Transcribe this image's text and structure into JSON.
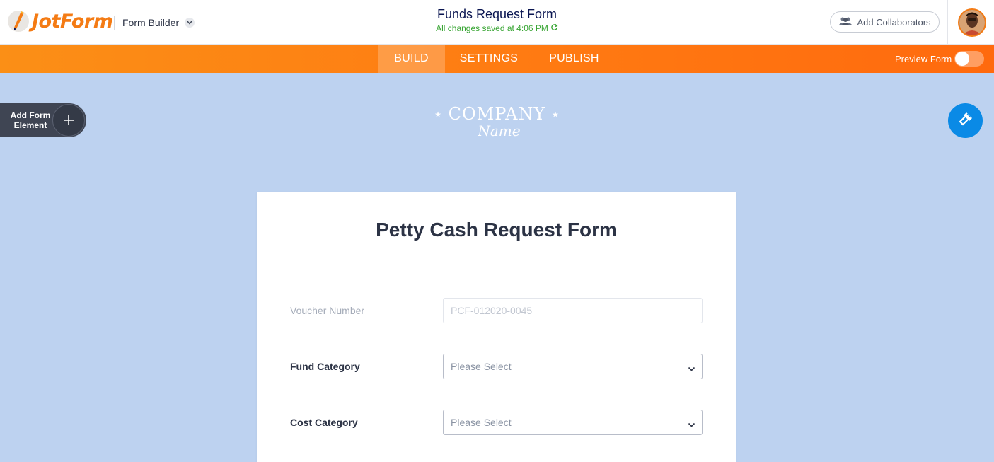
{
  "header": {
    "logo_text": "JotForm",
    "builder_menu_label": "Form Builder",
    "form_title": "Funds Request Form",
    "saved_status": "All changes saved at 4:06 PM",
    "collaborators_label": "Add Collaborators"
  },
  "nav": {
    "tabs": [
      {
        "label": "BUILD",
        "active": true
      },
      {
        "label": "SETTINGS",
        "active": false
      },
      {
        "label": "PUBLISH",
        "active": false
      }
    ],
    "preview_label": "Preview Form",
    "preview_enabled": false
  },
  "sidebar": {
    "add_element_label_1": "Add Form",
    "add_element_label_2": "Element"
  },
  "branding": {
    "company_top": "COMPANY",
    "company_sub": "Name"
  },
  "form": {
    "heading": "Petty Cash Request Form",
    "fields": [
      {
        "label": "Voucher Number",
        "placeholder": "PCF-012020-0045",
        "type": "text",
        "disabled": true
      },
      {
        "label": "Fund Category",
        "value": "Please Select",
        "type": "select"
      },
      {
        "label": "Cost Category",
        "value": "Please Select",
        "type": "select"
      }
    ]
  },
  "colors": {
    "brand_orange": "#ff7a12",
    "canvas_bg": "#bdd2f0",
    "designer_blue": "#0a8ae6",
    "saved_green": "#38a533",
    "title_navy": "#0a1551"
  }
}
